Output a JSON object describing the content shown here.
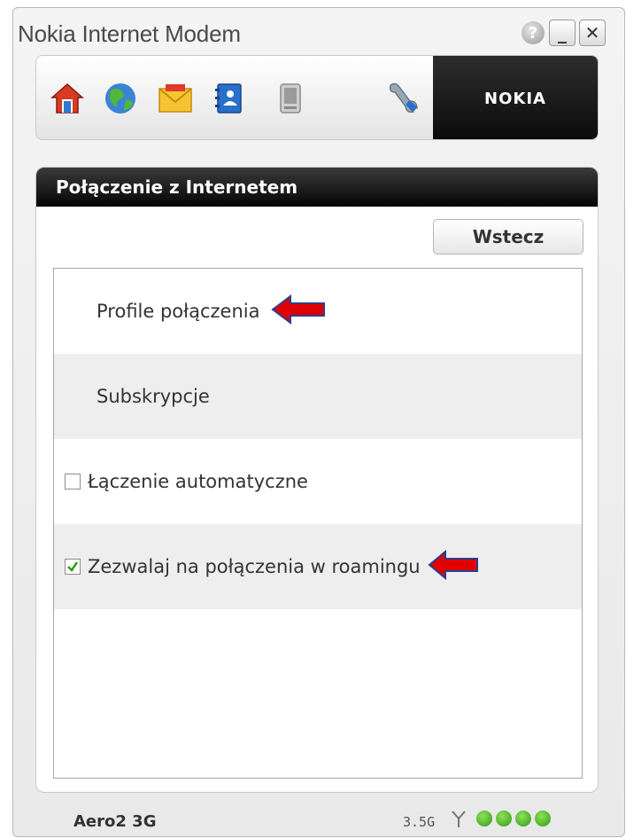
{
  "window": {
    "title": "Nokia Internet Modem",
    "help_label": "?",
    "minimize_label": "_",
    "close_label": "✕"
  },
  "toolbar": {
    "brand": "NOKIA",
    "icons": [
      "home-icon",
      "globe-icon",
      "envelope-icon",
      "contacts-icon",
      "storage-card-icon",
      "wrench-icon"
    ]
  },
  "panel": {
    "title": "Połączenie z Internetem",
    "back_button": "Wstecz",
    "items": [
      {
        "label": "Profile połączenia"
      },
      {
        "label": "Subskrypcje"
      },
      {
        "label": "Łączenie automatyczne",
        "checked": false
      },
      {
        "label": "Zezwalaj na połączenia w roamingu",
        "checked": true
      }
    ]
  },
  "status_bar": {
    "carrier": "Aero2 3G",
    "network_type": "3.5G",
    "signal_bars": 4
  },
  "colors": {
    "accent_arrow": "#e00000",
    "signal_green": "#3aa81b",
    "header_black": "#0b0b0b"
  }
}
